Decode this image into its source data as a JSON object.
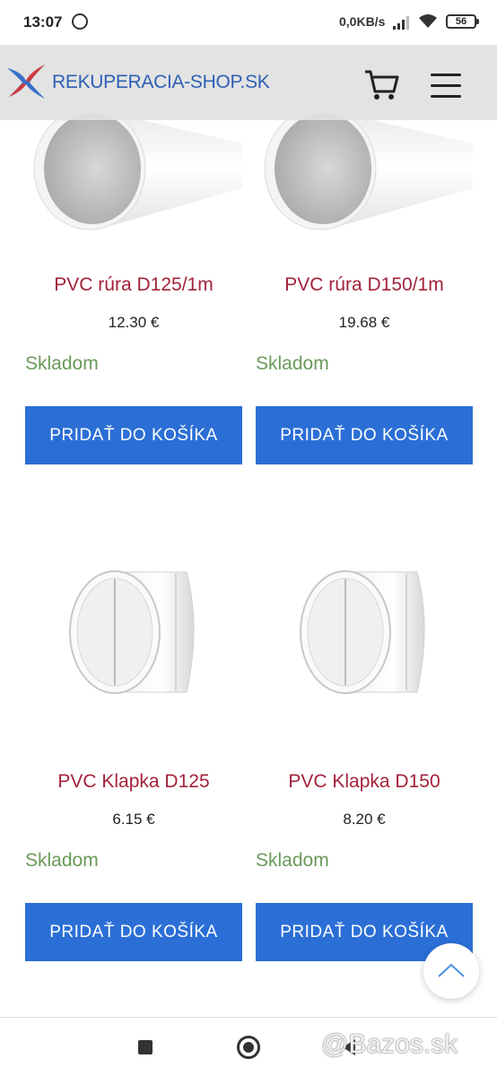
{
  "status_bar": {
    "time": "13:07",
    "network_speed": "0,0KB/s",
    "battery": "56"
  },
  "header": {
    "logo_text": "REKUPERACIA-SHOP.SK",
    "cart_icon": "cart-icon",
    "menu_icon": "hamburger-menu-icon"
  },
  "products": [
    {
      "name": "PVC rúra D125/1m",
      "price": "12.30 €",
      "stock": "Skladom",
      "button": "PRIDAŤ DO KOŠÍKA",
      "image": "pvc-pipe"
    },
    {
      "name": "PVC rúra D150/1m",
      "price": "19.68 €",
      "stock": "Skladom",
      "button": "PRIDAŤ DO KOŠÍKA",
      "image": "pvc-pipe"
    },
    {
      "name": "PVC Klapka D125",
      "price": "6.15 €",
      "stock": "Skladom",
      "button": "PRIDAŤ DO KOŠÍKA",
      "image": "pvc-valve"
    },
    {
      "name": "PVC Klapka D150",
      "price": "8.20 €",
      "stock": "Skladom",
      "button": "PRIDAŤ DO KOŠÍKA",
      "image": "pvc-valve"
    }
  ],
  "watermark": "@Bazos.sk",
  "colors": {
    "accent": "#2b6fd6",
    "product_name": "#a3223a",
    "stock": "#6a9a5a",
    "logo": "#2e5fb5"
  }
}
